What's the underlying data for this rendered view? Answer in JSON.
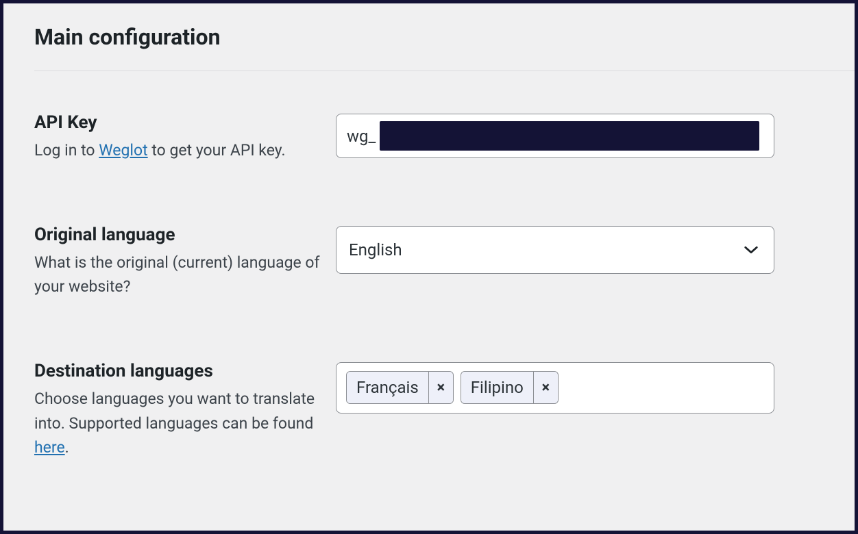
{
  "section_title": "Main configuration",
  "api_key": {
    "label": "API Key",
    "description_prefix": "Log in to ",
    "description_link_text": "Weglot",
    "description_suffix": " to get your API key.",
    "value_prefix": "wg_"
  },
  "original_language": {
    "label": "Original language",
    "description": "What is the original (current) language of your website?",
    "selected": "English"
  },
  "destination_languages": {
    "label": "Destination languages",
    "description_prefix": "Choose languages you want to translate into. Supported languages can be found ",
    "description_link_text": "here",
    "description_suffix": ".",
    "tags": [
      {
        "label": "Français"
      },
      {
        "label": "Filipino"
      }
    ]
  }
}
